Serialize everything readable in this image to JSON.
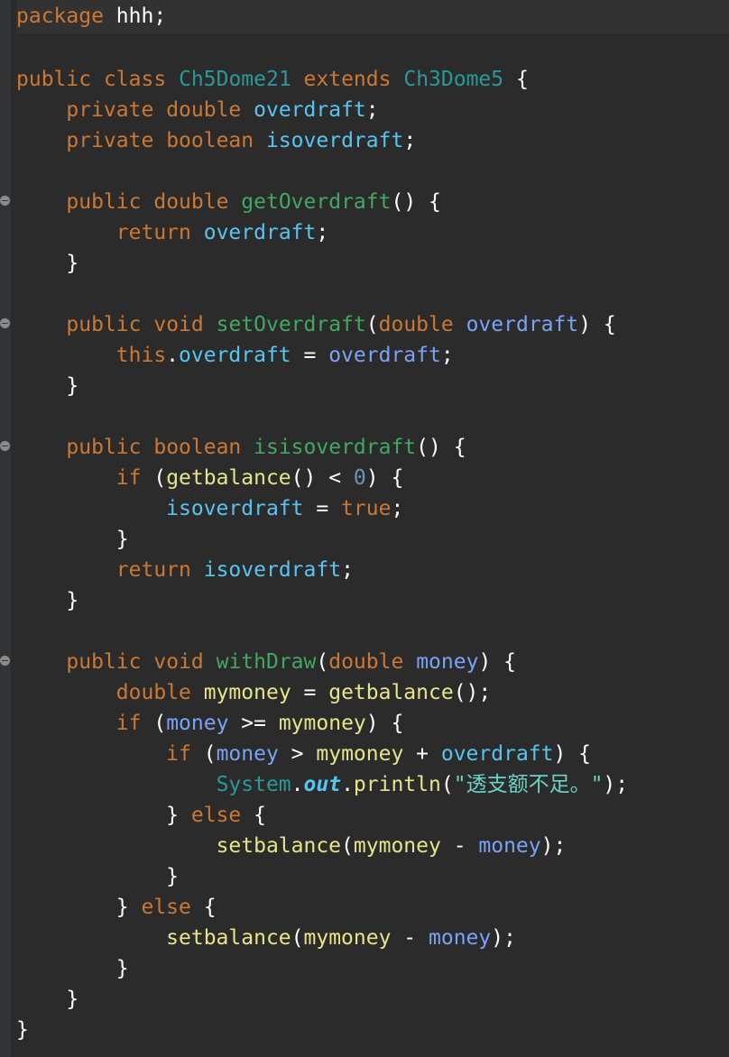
{
  "lines": [
    [
      [
        "kw",
        "package"
      ],
      [
        "plain",
        " hhh;"
      ]
    ],
    [],
    [
      [
        "kw",
        "public"
      ],
      [
        "plain",
        " "
      ],
      [
        "kw",
        "class"
      ],
      [
        "plain",
        " "
      ],
      [
        "cls",
        "Ch5Dome21"
      ],
      [
        "plain",
        " "
      ],
      [
        "kw",
        "extends"
      ],
      [
        "plain",
        " "
      ],
      [
        "cls",
        "Ch3Dome5"
      ],
      [
        "plain",
        " {"
      ]
    ],
    [
      [
        "plain",
        "    "
      ],
      [
        "kw",
        "private"
      ],
      [
        "plain",
        " "
      ],
      [
        "kw",
        "double"
      ],
      [
        "plain",
        " "
      ],
      [
        "field",
        "overdraft"
      ],
      [
        "plain",
        ";"
      ]
    ],
    [
      [
        "plain",
        "    "
      ],
      [
        "kw",
        "private"
      ],
      [
        "plain",
        " "
      ],
      [
        "kw",
        "boolean"
      ],
      [
        "plain",
        " "
      ],
      [
        "field",
        "isoverdraft"
      ],
      [
        "plain",
        ";"
      ]
    ],
    [],
    [
      [
        "plain",
        "    "
      ],
      [
        "kw",
        "public"
      ],
      [
        "plain",
        " "
      ],
      [
        "kw",
        "double"
      ],
      [
        "plain",
        " "
      ],
      [
        "method",
        "getOverdraft"
      ],
      [
        "plain",
        "() {"
      ]
    ],
    [
      [
        "plain",
        "        "
      ],
      [
        "kw",
        "return"
      ],
      [
        "plain",
        " "
      ],
      [
        "field",
        "overdraft"
      ],
      [
        "plain",
        ";"
      ]
    ],
    [
      [
        "plain",
        "    }"
      ]
    ],
    [],
    [
      [
        "plain",
        "    "
      ],
      [
        "kw",
        "public"
      ],
      [
        "plain",
        " "
      ],
      [
        "kw",
        "void"
      ],
      [
        "plain",
        " "
      ],
      [
        "method",
        "setOverdraft"
      ],
      [
        "plain",
        "("
      ],
      [
        "kw",
        "double"
      ],
      [
        "plain",
        " "
      ],
      [
        "param",
        "overdraft"
      ],
      [
        "plain",
        ") {"
      ]
    ],
    [
      [
        "plain",
        "        "
      ],
      [
        "kw",
        "this"
      ],
      [
        "plain",
        "."
      ],
      [
        "field",
        "overdraft"
      ],
      [
        "plain",
        " = "
      ],
      [
        "param",
        "overdraft"
      ],
      [
        "plain",
        ";"
      ]
    ],
    [
      [
        "plain",
        "    }"
      ]
    ],
    [],
    [
      [
        "plain",
        "    "
      ],
      [
        "kw",
        "public"
      ],
      [
        "plain",
        " "
      ],
      [
        "kw",
        "boolean"
      ],
      [
        "plain",
        " "
      ],
      [
        "method",
        "isisoverdraft"
      ],
      [
        "plain",
        "() {"
      ]
    ],
    [
      [
        "plain",
        "        "
      ],
      [
        "kw",
        "if"
      ],
      [
        "plain",
        " ("
      ],
      [
        "call",
        "getbalance"
      ],
      [
        "plain",
        "() < "
      ],
      [
        "num",
        "0"
      ],
      [
        "plain",
        ") {"
      ]
    ],
    [
      [
        "plain",
        "            "
      ],
      [
        "field",
        "isoverdraft"
      ],
      [
        "plain",
        " = "
      ],
      [
        "kw",
        "true"
      ],
      [
        "plain",
        ";"
      ]
    ],
    [
      [
        "plain",
        "        }"
      ]
    ],
    [
      [
        "plain",
        "        "
      ],
      [
        "kw",
        "return"
      ],
      [
        "plain",
        " "
      ],
      [
        "field",
        "isoverdraft"
      ],
      [
        "plain",
        ";"
      ]
    ],
    [
      [
        "plain",
        "    }"
      ]
    ],
    [],
    [
      [
        "plain",
        "    "
      ],
      [
        "kw",
        "public"
      ],
      [
        "plain",
        " "
      ],
      [
        "kw",
        "void"
      ],
      [
        "plain",
        " "
      ],
      [
        "method",
        "withDraw"
      ],
      [
        "plain",
        "("
      ],
      [
        "kw",
        "double"
      ],
      [
        "plain",
        " "
      ],
      [
        "param",
        "money"
      ],
      [
        "plain",
        ") {"
      ]
    ],
    [
      [
        "plain",
        "        "
      ],
      [
        "kw",
        "double"
      ],
      [
        "plain",
        " "
      ],
      [
        "local",
        "mymoney"
      ],
      [
        "plain",
        " = "
      ],
      [
        "call",
        "getbalance"
      ],
      [
        "plain",
        "();"
      ]
    ],
    [
      [
        "plain",
        "        "
      ],
      [
        "kw",
        "if"
      ],
      [
        "plain",
        " ("
      ],
      [
        "param",
        "money"
      ],
      [
        "plain",
        " >= "
      ],
      [
        "local",
        "mymoney"
      ],
      [
        "plain",
        ") {"
      ]
    ],
    [
      [
        "plain",
        "            "
      ],
      [
        "kw",
        "if"
      ],
      [
        "plain",
        " ("
      ],
      [
        "param",
        "money"
      ],
      [
        "plain",
        " > "
      ],
      [
        "local",
        "mymoney"
      ],
      [
        "plain",
        " + "
      ],
      [
        "field",
        "overdraft"
      ],
      [
        "plain",
        ") {"
      ]
    ],
    [
      [
        "plain",
        "                "
      ],
      [
        "sys",
        "System"
      ],
      [
        "plain",
        "."
      ],
      [
        "static",
        "out"
      ],
      [
        "plain",
        "."
      ],
      [
        "call",
        "println"
      ],
      [
        "plain",
        "("
      ],
      [
        "str",
        "\"透支额不足。\""
      ],
      [
        "plain",
        ");"
      ]
    ],
    [
      [
        "plain",
        "            } "
      ],
      [
        "kw",
        "else"
      ],
      [
        "plain",
        " {"
      ]
    ],
    [
      [
        "plain",
        "                "
      ],
      [
        "call",
        "setbalance"
      ],
      [
        "plain",
        "("
      ],
      [
        "local",
        "mymoney"
      ],
      [
        "plain",
        " - "
      ],
      [
        "param",
        "money"
      ],
      [
        "plain",
        ");"
      ]
    ],
    [
      [
        "plain",
        "            }"
      ]
    ],
    [
      [
        "plain",
        "        } "
      ],
      [
        "kw",
        "else"
      ],
      [
        "plain",
        " {"
      ]
    ],
    [
      [
        "plain",
        "            "
      ],
      [
        "call",
        "setbalance"
      ],
      [
        "plain",
        "("
      ],
      [
        "local",
        "mymoney"
      ],
      [
        "plain",
        " - "
      ],
      [
        "param",
        "money"
      ],
      [
        "plain",
        ");"
      ]
    ],
    [
      [
        "plain",
        "        }"
      ]
    ],
    [
      [
        "plain",
        "    }"
      ]
    ],
    [
      [
        "plain",
        "}"
      ]
    ]
  ],
  "fold_marker_lines": [
    6,
    10,
    14,
    21
  ],
  "current_line": 0
}
